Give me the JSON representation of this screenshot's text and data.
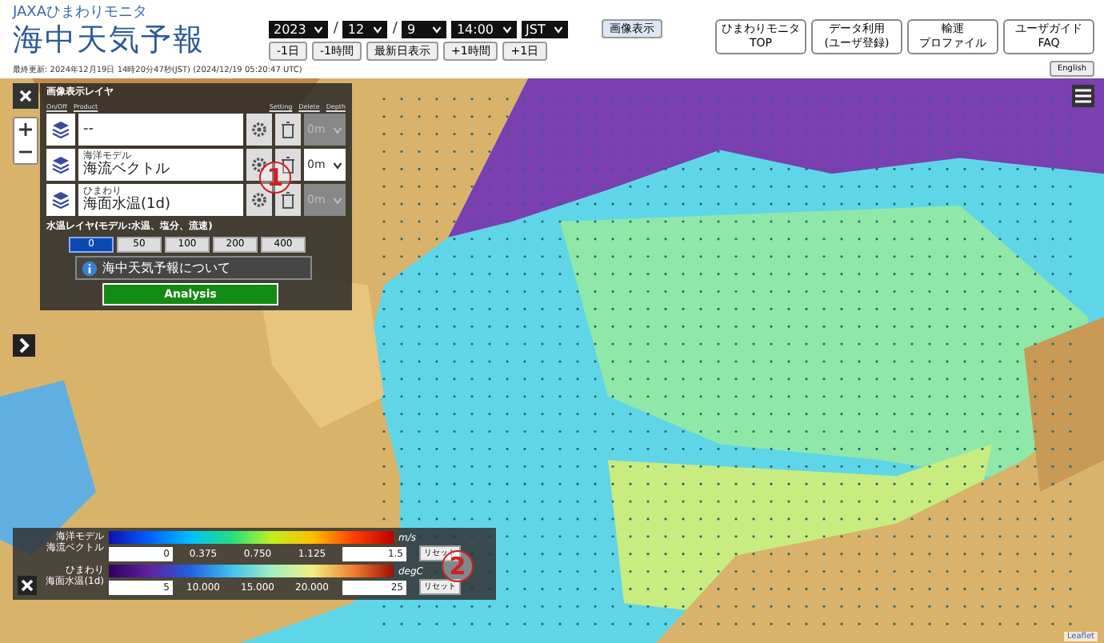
{
  "header": {
    "subtitle": "JAXAひまわりモニタ",
    "title": "海中天気予報",
    "last_update": "最終更新: 2024年12月19日 14時20分47秒(JST) (2024/12/19 05:20:47 UTC)"
  },
  "date_controls": {
    "selects": [
      {
        "value": "2023",
        "separator": "/"
      },
      {
        "value": "12",
        "separator": "/"
      },
      {
        "value": "9"
      },
      {
        "value": "14:00"
      },
      {
        "value": "JST"
      }
    ],
    "steps": [
      "-1日",
      "-1時間",
      "最新日表示",
      "+1時間",
      "+1日"
    ],
    "show_button": "画像表示"
  },
  "nav_buttons": [
    {
      "lines": [
        "ひまわりモニタ",
        "TOP"
      ]
    },
    {
      "lines": [
        "データ利用",
        "(ユーザ登録)"
      ]
    },
    {
      "lines": [
        "輸運",
        "プロファイル"
      ]
    },
    {
      "lines": [
        "ユーザガイド",
        "FAQ"
      ]
    }
  ],
  "language_button": "English",
  "layer_panel": {
    "title": "画像表示レイヤ",
    "columns": [
      "On/Off",
      "Product",
      "Setting",
      "Delete",
      "Depth"
    ],
    "layers": [
      {
        "product": "--",
        "depth": "0m",
        "disabled": true
      },
      {
        "category": "海洋モデル",
        "product": "海流ベクトル",
        "depth": "0m",
        "disabled": false
      },
      {
        "category": "ひまわり",
        "product": "海面水温(1d)",
        "depth": "0m",
        "disabled": true
      }
    ],
    "depth_title": "水温レイヤ(モデル:水温、塩分、流速)",
    "depths": [
      {
        "label": "0",
        "selected": true
      },
      {
        "label": "50",
        "selected": false
      },
      {
        "label": "100",
        "selected": false
      },
      {
        "label": "200",
        "selected": false
      },
      {
        "label": "400",
        "selected": false
      }
    ],
    "info": "海中天気予報について",
    "analysis_button": "Analysis"
  },
  "legends": [
    {
      "category": "海洋モデル",
      "product": "海流ベクトル",
      "unit": "m/s",
      "min": "0",
      "ticks": [
        "0.375",
        "0.750",
        "1.125"
      ],
      "max": "1.5",
      "reset": "リセット",
      "kind": "rainbow"
    },
    {
      "category": "ひまわり",
      "product": "海面水温(1d)",
      "unit": "degC",
      "min": "5",
      "ticks": [
        "10.000",
        "15.000",
        "20.000"
      ],
      "max": "25",
      "reset": "リセット",
      "kind": "thermal"
    }
  ],
  "callouts": [
    "1",
    "2"
  ],
  "attribution": "Leaflet"
}
